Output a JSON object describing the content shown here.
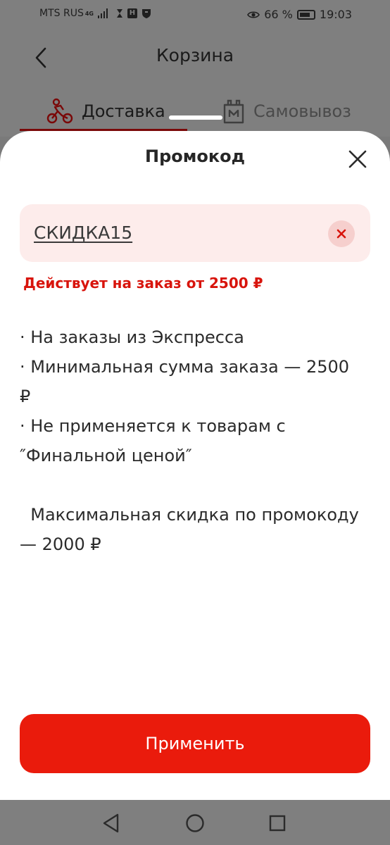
{
  "status_bar": {
    "carrier": "MTS RUS",
    "network": "4G",
    "battery_percent": "66 %",
    "time": "19:03"
  },
  "page": {
    "title": "Корзина",
    "tabs": [
      {
        "label": "Доставка",
        "icon": "bicycle-courier-icon",
        "active": true
      },
      {
        "label": "Самовывоз",
        "icon": "shopping-bag-icon",
        "active": false
      }
    ]
  },
  "promo_sheet": {
    "title": "Промокод",
    "code_value": "СКИДКА15",
    "error_text": "Действует на заказ от 2500 ₽",
    "terms": [
      "· На заказы из Экспресса",
      "· Минимальная сумма заказа — 2500",
      "₽",
      "· Не применяется к товарам с",
      "″Финальной ценой″",
      "",
      "  Максимальная скидка по промокоду",
      "— 2000 ₽"
    ],
    "apply_label": "Применить"
  },
  "colors": {
    "accent": "#ea1b0c",
    "error": "#d8140c",
    "field_bg": "#fdeceb",
    "overlay": "#7f7f7f"
  }
}
